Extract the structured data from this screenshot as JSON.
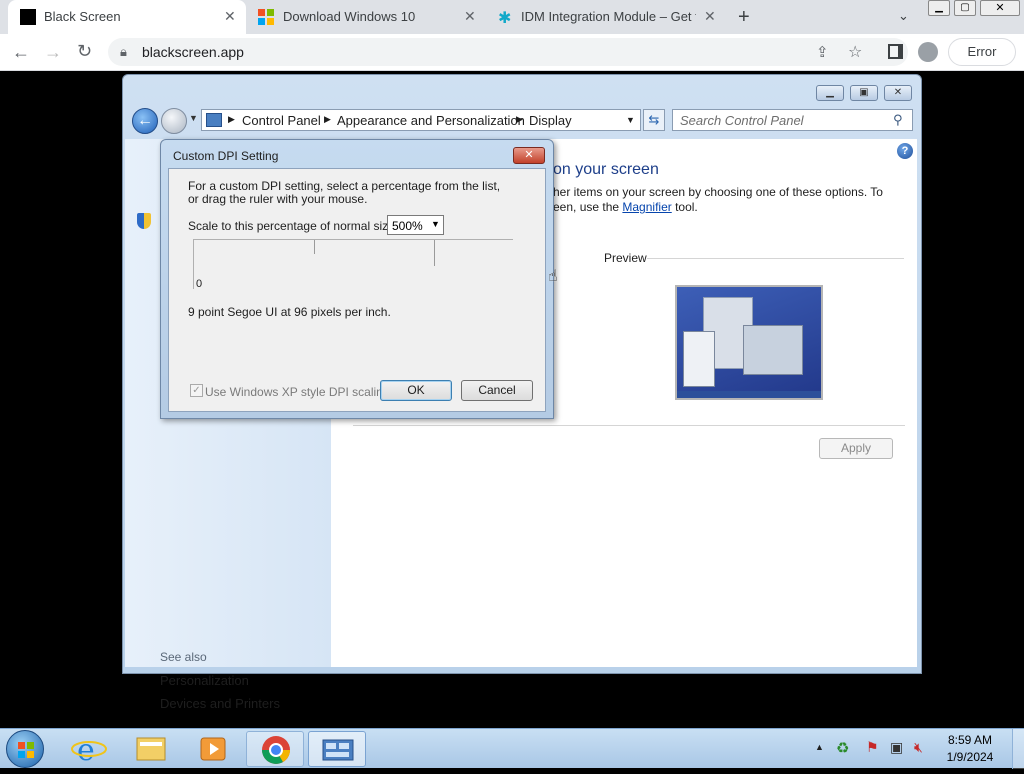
{
  "browser": {
    "tabs": [
      {
        "title": "Black Screen",
        "active": true,
        "icon": "black-square-favicon"
      },
      {
        "title": "Download Windows 10",
        "active": false,
        "icon": "windows-logo-favicon"
      },
      {
        "title": "IDM Integration Module – Get th",
        "active": false,
        "icon": "idm-favicon"
      }
    ],
    "url": "blackscreen.app",
    "profile_button": "Error"
  },
  "explorer": {
    "breadcrumb": [
      "Control Panel",
      "Appearance and Personalization",
      "Display"
    ],
    "search_placeholder": "Search Control Panel",
    "heading": "on your screen",
    "line1": "her items on your screen by choosing one of these options. To",
    "line2_prefix": "een, use the ",
    "magnifier_link": "Magnifier",
    "line2_suffix": " tool.",
    "preview_label": "Preview",
    "apply_button": "Apply",
    "see_also_label": "See also",
    "see_also_links": [
      "Personalization",
      "Devices and Printers"
    ]
  },
  "dialog": {
    "title": "Custom DPI Setting",
    "instructions": "For a custom DPI setting, select a percentage from the list, or drag the ruler with your mouse.",
    "scale_label": "Scale to this percentage of normal size:",
    "scale_value": "500%",
    "ruler_zero": "0",
    "font_info": "9 point Segoe UI at 96 pixels per inch.",
    "xp_checkbox_label": "Use Windows XP style DPI scaling",
    "xp_checkbox_checked": true,
    "ok_button": "OK",
    "cancel_button": "Cancel"
  },
  "taskbar": {
    "time": "8:59 AM",
    "date": "1/9/2024"
  }
}
